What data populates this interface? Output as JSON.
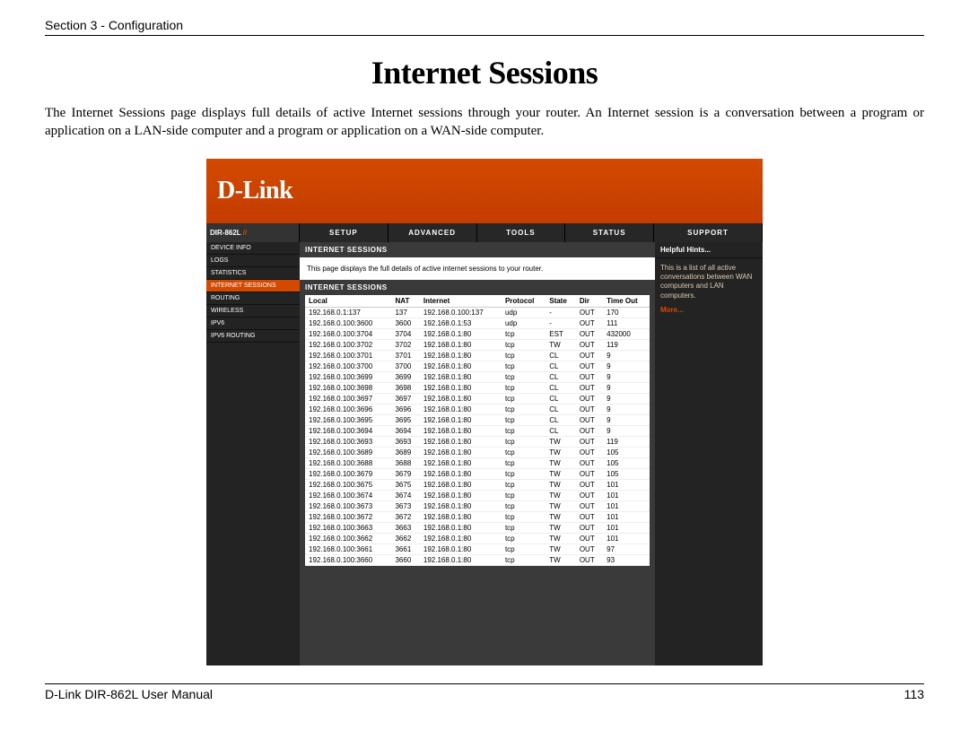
{
  "header": "Section 3 - Configuration",
  "main_title": "Internet Sessions",
  "intro": "The Internet Sessions page displays full details of active Internet sessions through your router. An Internet session is a conversation between a program or application on a LAN-side computer and a program or application on a WAN-side computer.",
  "dlink_logo": "D-Link",
  "model": "DIR-862L",
  "tabs": [
    "SETUP",
    "ADVANCED",
    "TOOLS",
    "STATUS",
    "SUPPORT"
  ],
  "sidebar": {
    "items": [
      "DEVICE INFO",
      "LOGS",
      "STATISTICS",
      "INTERNET SESSIONS",
      "ROUTING",
      "WIRELESS",
      "IPV6",
      "IPV6 ROUTING"
    ],
    "active_index": 3
  },
  "panel": {
    "heading1": "INTERNET SESSIONS",
    "desc": "This page displays the full details of active internet sessions to your router.",
    "heading2": "INTERNET SESSIONS"
  },
  "hints": {
    "title": "Helpful Hints...",
    "body": "This is a list of all active conversations between WAN computers and LAN computers.",
    "more": "More..."
  },
  "table": {
    "columns": [
      "Local",
      "NAT",
      "Internet",
      "Protocol",
      "State",
      "Dir",
      "Time Out"
    ],
    "rows": [
      [
        "192.168.0.1:137",
        "137",
        "192.168.0.100:137",
        "udp",
        "-",
        "OUT",
        "170"
      ],
      [
        "192.168.0.100:3600",
        "3600",
        "192.168.0.1:53",
        "udp",
        "-",
        "OUT",
        "111"
      ],
      [
        "192.168.0.100:3704",
        "3704",
        "192.168.0.1:80",
        "tcp",
        "EST",
        "OUT",
        "432000"
      ],
      [
        "192.168.0.100:3702",
        "3702",
        "192.168.0.1:80",
        "tcp",
        "TW",
        "OUT",
        "119"
      ],
      [
        "192.168.0.100:3701",
        "3701",
        "192.168.0.1:80",
        "tcp",
        "CL",
        "OUT",
        "9"
      ],
      [
        "192.168.0.100:3700",
        "3700",
        "192.168.0.1:80",
        "tcp",
        "CL",
        "OUT",
        "9"
      ],
      [
        "192.168.0.100:3699",
        "3699",
        "192.168.0.1:80",
        "tcp",
        "CL",
        "OUT",
        "9"
      ],
      [
        "192.168.0.100:3698",
        "3698",
        "192.168.0.1:80",
        "tcp",
        "CL",
        "OUT",
        "9"
      ],
      [
        "192.168.0.100:3697",
        "3697",
        "192.168.0.1:80",
        "tcp",
        "CL",
        "OUT",
        "9"
      ],
      [
        "192.168.0.100:3696",
        "3696",
        "192.168.0.1:80",
        "tcp",
        "CL",
        "OUT",
        "9"
      ],
      [
        "192.168.0.100:3695",
        "3695",
        "192.168.0.1:80",
        "tcp",
        "CL",
        "OUT",
        "9"
      ],
      [
        "192.168.0.100:3694",
        "3694",
        "192.168.0.1:80",
        "tcp",
        "CL",
        "OUT",
        "9"
      ],
      [
        "192.168.0.100:3693",
        "3693",
        "192.168.0.1:80",
        "tcp",
        "TW",
        "OUT",
        "119"
      ],
      [
        "192.168.0.100:3689",
        "3689",
        "192.168.0.1:80",
        "tcp",
        "TW",
        "OUT",
        "105"
      ],
      [
        "192.168.0.100:3688",
        "3688",
        "192.168.0.1:80",
        "tcp",
        "TW",
        "OUT",
        "105"
      ],
      [
        "192.168.0.100:3679",
        "3679",
        "192.168.0.1:80",
        "tcp",
        "TW",
        "OUT",
        "105"
      ],
      [
        "192.168.0.100:3675",
        "3675",
        "192.168.0.1:80",
        "tcp",
        "TW",
        "OUT",
        "101"
      ],
      [
        "192.168.0.100:3674",
        "3674",
        "192.168.0.1:80",
        "tcp",
        "TW",
        "OUT",
        "101"
      ],
      [
        "192.168.0.100:3673",
        "3673",
        "192.168.0.1:80",
        "tcp",
        "TW",
        "OUT",
        "101"
      ],
      [
        "192.168.0.100:3672",
        "3672",
        "192.168.0.1:80",
        "tcp",
        "TW",
        "OUT",
        "101"
      ],
      [
        "192.168.0.100:3663",
        "3663",
        "192.168.0.1:80",
        "tcp",
        "TW",
        "OUT",
        "101"
      ],
      [
        "192.168.0.100:3662",
        "3662",
        "192.168.0.1:80",
        "tcp",
        "TW",
        "OUT",
        "101"
      ],
      [
        "192.168.0.100:3661",
        "3661",
        "192.168.0.1:80",
        "tcp",
        "TW",
        "OUT",
        "97"
      ],
      [
        "192.168.0.100:3660",
        "3660",
        "192.168.0.1:80",
        "tcp",
        "TW",
        "OUT",
        "93"
      ]
    ]
  },
  "footer_left": "D-Link DIR-862L User Manual",
  "footer_right": "113"
}
